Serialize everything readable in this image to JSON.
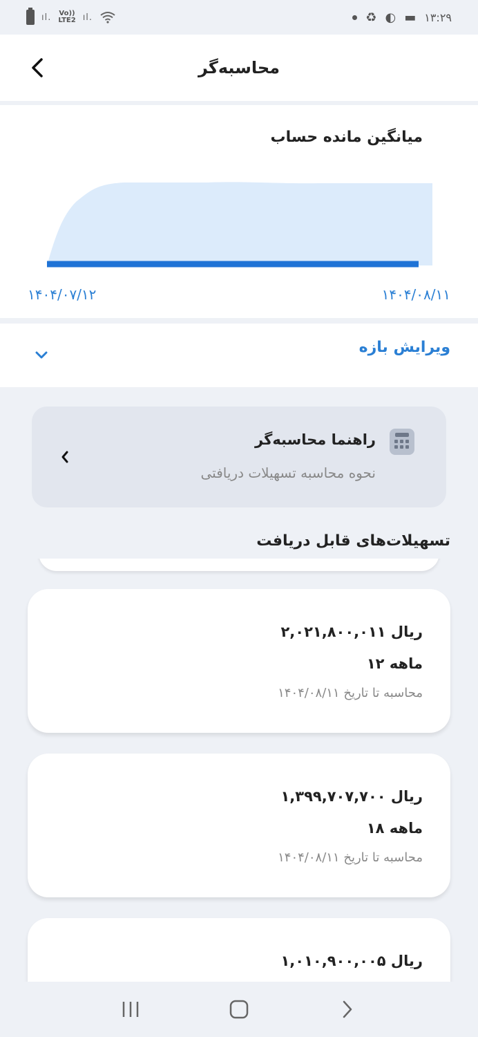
{
  "status_bar": {
    "time": "۱۳:۲۹",
    "network_label": "LTE2",
    "volte_label": "Vo))"
  },
  "header": {
    "title": "محاسبه‌گر"
  },
  "chart_data": {
    "type": "area",
    "title": "میانگین مانده حساب",
    "x_start_label": "۱۴۰۴/۰۷/۱۲",
    "x_end_label": "۱۴۰۴/۰۸/۱۱",
    "fill_color": "#dcebfb",
    "line_color": "#1f73d6"
  },
  "range": {
    "label": "ویرایش بازه"
  },
  "guide": {
    "title": "راهنما محاسبه‌گر",
    "subtitle": "نحوه محاسبه تسهیلات دریافتی"
  },
  "loans_section": {
    "title": "تسهیلات‌های قابل دریافت",
    "items": [
      {
        "amount": "۲,۰۲۱,۸۰۰,۰۱۱ ریال",
        "term": "۱۲ ماهه",
        "date": "محاسبه تا تاریخ ۱۴۰۴/۰۸/۱۱"
      },
      {
        "amount": "۱,۳۹۹,۷۰۷,۷۰۰ ریال",
        "term": "۱۸ ماهه",
        "date": "محاسبه تا تاریخ ۱۴۰۴/۰۸/۱۱"
      },
      {
        "amount": "۱,۰۱۰,۹۰۰,۰۰۵ ریال"
      }
    ]
  },
  "colors": {
    "accent": "#2a7fd4",
    "background": "#eef1f6",
    "card": "#ffffff"
  }
}
